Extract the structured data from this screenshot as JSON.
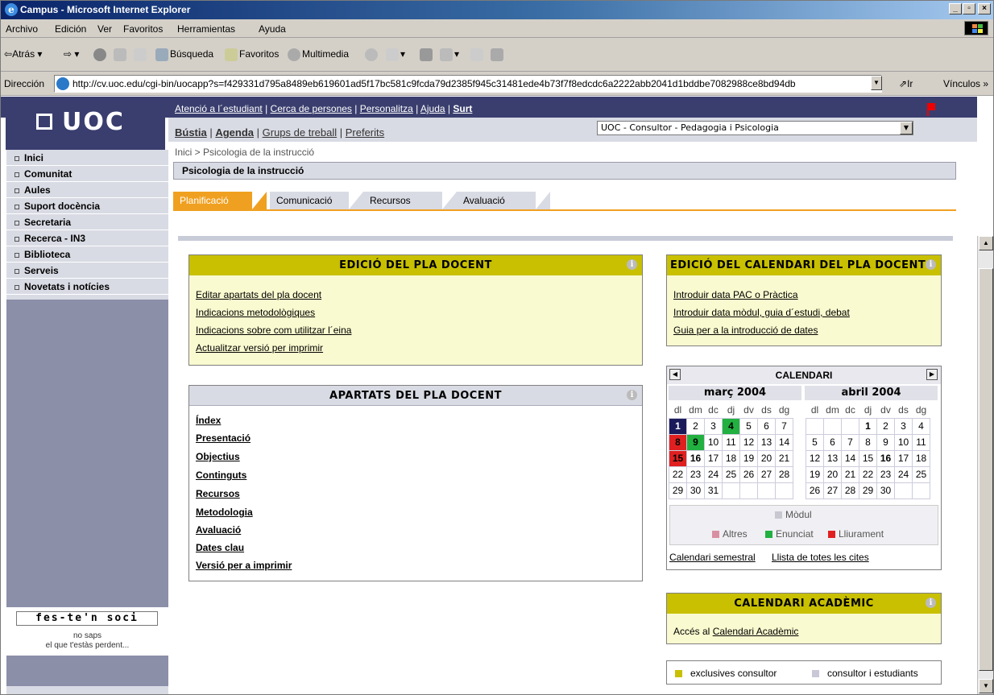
{
  "window": {
    "title": "Campus - Microsoft Internet Explorer",
    "menu": [
      "Archivo",
      "Edición",
      "Ver",
      "Favoritos",
      "Herramientas",
      "Ayuda"
    ],
    "toolbar": {
      "back": "Atrás",
      "search": "Búsqueda",
      "favorites": "Favoritos",
      "multimedia": "Multimedia"
    },
    "address_label": "Dirección",
    "address_url": "http://cv.uoc.edu/cgi-bin/uocapp?s=f429331d795a8489eb619601ad5f17bc581c9fcda79d2385f945c31481ede4b73f7f8edcdc6a2222abb2041d1bddbe7082988ce8bd94db",
    "go_label": "Ir",
    "links_label": "Vínculos"
  },
  "site": {
    "logo": "UOC",
    "top_links": [
      "Atenció a l´estudiant",
      "Cerca de persones",
      "Personalitza",
      "Ajuda",
      "Surt"
    ],
    "nav_links": [
      "Bústia",
      "Agenda",
      "Grups de treball",
      "Preferits"
    ],
    "context_select": "UOC - Consultor - Pedagogia i Psicologia",
    "sidebar": [
      "Inici",
      "Comunitat",
      "Aules",
      "Suport docència",
      "Secretaria",
      "Recerca - IN3",
      "Biblioteca",
      "Serveis",
      "Novetats i notícies"
    ],
    "feste": {
      "title": "fes-te'n soci",
      "line1": "no saps",
      "line2": "el que t'estàs perdent..."
    },
    "breadcrumb": "Inici  > Psicologia de la instrucció",
    "page_title": "Psicologia de la instrucció",
    "tabs": [
      "Planificació",
      "Comunicació",
      "Recursos",
      "Avaluació"
    ]
  },
  "panels": {
    "edicio_pla": {
      "title": "EDICIÓ DEL PLA DOCENT",
      "links": [
        "Editar apartats del pla docent",
        "Indicacions metodològiques",
        "Indicacions sobre com utilitzar l´eina",
        "Actualitzar versió per imprimir"
      ]
    },
    "apartats": {
      "title": "APARTATS DEL PLA DOCENT",
      "links": [
        "Índex",
        "Presentació",
        "Objectius",
        "Continguts",
        "Recursos",
        "Metodologia",
        "Avaluació",
        "Dates clau",
        "Versió per a imprimir"
      ]
    },
    "edicio_cal": {
      "title": "EDICIÓ DEL CALENDARI DEL PLA DOCENT",
      "links": [
        "Introduir data PAC o Pràctica",
        "Introduir data mòdul, guia d´estudi, debat",
        "Guia per a la introducció de dates"
      ]
    },
    "calendari": {
      "title": "CALENDARI",
      "month1": "març 2004",
      "month2": "abril 2004",
      "days": [
        "dl",
        "dm",
        "dc",
        "dj",
        "dv",
        "ds",
        "dg"
      ],
      "legend_modul": "Mòdul",
      "legend_altres": "Altres",
      "legend_enunciat": "Enunciat",
      "legend_lliurament": "Lliurament",
      "link_semestral": "Calendari semestral",
      "link_cites": "Llista de totes les cites"
    },
    "academic": {
      "title": "CALENDARI ACADÈMIC",
      "text_prefix": "Accés al",
      "link": "Calendari Acadèmic"
    },
    "legend": {
      "consultor": "exclusives consultor",
      "estudiants": "consultor i estudiants"
    }
  },
  "colors": {
    "accent": "#f0a020",
    "olive": "#c8c000",
    "panel_bg": "#fafad0",
    "header": "#3a3e6e",
    "green": "#22b040",
    "red": "#e02020",
    "navy": "#1a1a5a"
  }
}
